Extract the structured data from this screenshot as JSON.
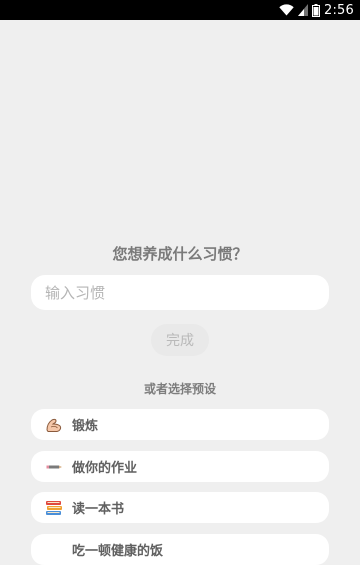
{
  "status_bar": {
    "time": "2:56",
    "icons": [
      "wifi-icon",
      "cell-signal-icon",
      "battery-icon"
    ]
  },
  "form": {
    "question": "您想养成什么习惯？",
    "input_placeholder": "输入习惯",
    "input_value": "",
    "done_label": "完成"
  },
  "presets": {
    "caption": "或者选择预设",
    "items": [
      {
        "icon": "flexed-biceps-icon",
        "label": "锻炼"
      },
      {
        "icon": "pencil-icon",
        "label": "做你的作业"
      },
      {
        "icon": "books-icon",
        "label": "读一本书"
      },
      {
        "icon": "",
        "label": "吃一顿健康的饭"
      }
    ]
  }
}
